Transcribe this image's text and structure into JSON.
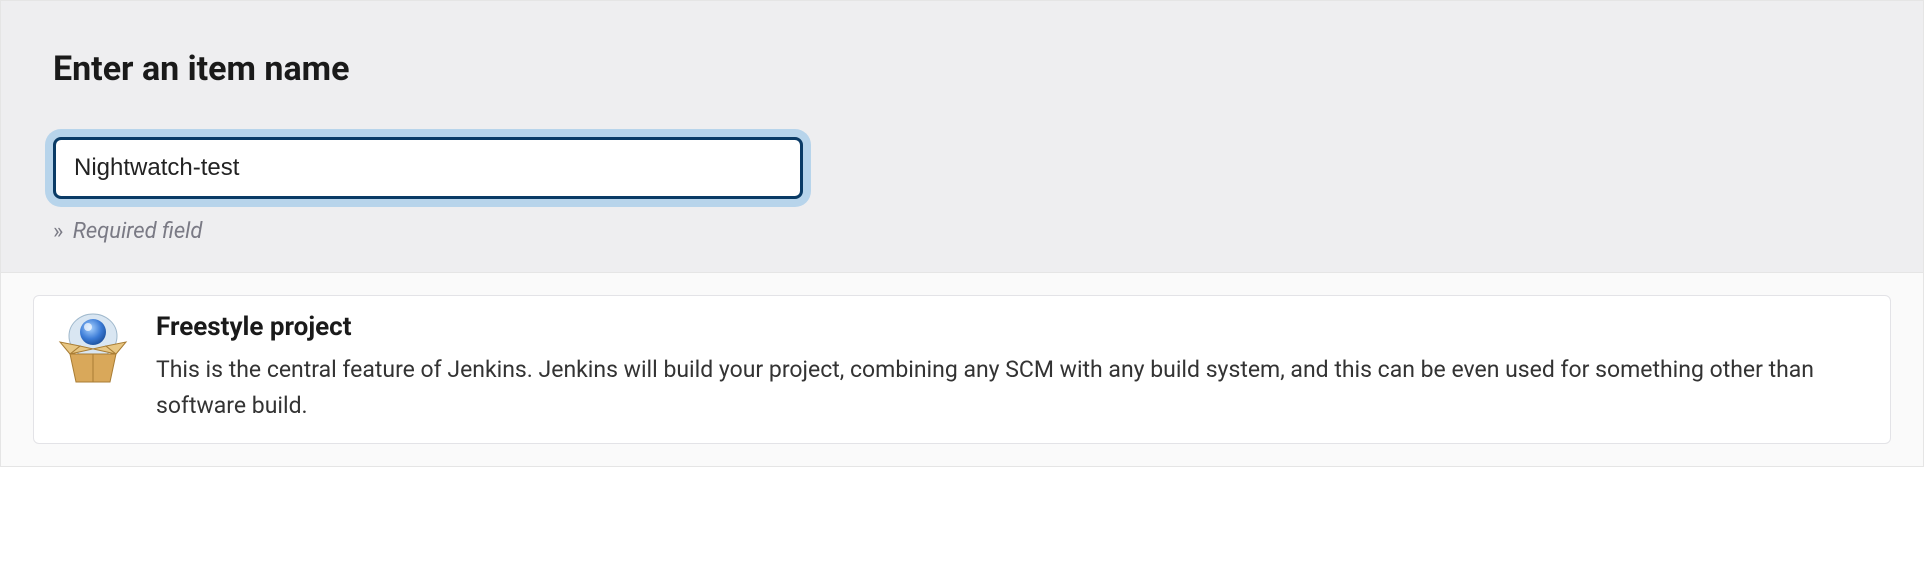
{
  "header": {
    "title": "Enter an item name",
    "name_value": "Nightwatch-test",
    "hint_prefix": "»",
    "hint_text": "Required field"
  },
  "items": [
    {
      "icon": "freestyle-project-icon",
      "title": "Freestyle project",
      "description": "This is the central feature of Jenkins. Jenkins will build your project, combining any SCM with any build system, and this can be even used for something other than software build."
    }
  ]
}
